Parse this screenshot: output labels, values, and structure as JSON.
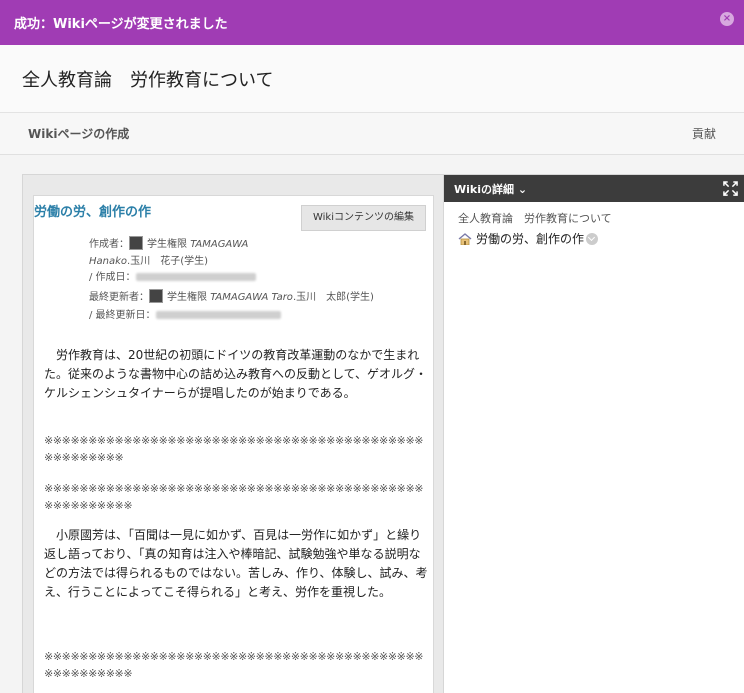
{
  "banner": {
    "message": "成功：Wikiページが変更されました",
    "close_icon": "×"
  },
  "page": {
    "title": "全人教育論　労作教育について"
  },
  "subbar": {
    "left": "Wikiページの作成",
    "right": "貢献"
  },
  "card": {
    "title": "労働の労、創作の作",
    "edit_label": "Wikiコンテンツの編集",
    "author_label": "作成者：",
    "author_name_1": "学生権限",
    "author_name_2": "TAMAGAWA",
    "author_name_3": "Hanako",
    "author_name_4": ".玉川　花子(学生)",
    "created_label": "/ 作成日：",
    "updated_by_label": "最終更新者：",
    "updated_by_1": "学生権限",
    "updated_by_2": "TAMAGAWA Taro",
    "updated_by_3": ".玉川　太郎(学生)",
    "updated_label": "/ 最終更新日：",
    "para1": "　労作教育は、20世紀の初頭にドイツの教育改革運動のなかで生まれた。従来のような書物中心の詰め込み教育への反動として、ゲオルグ・ケルシェンシュタイナーらが提唱したのが始まりである。",
    "marks1": "※※※※※※※※※※※※※※※※※※※※※※※※※※※※※※※※※※※※※※※※※※※※※※※※※※※※",
    "marks2": "※※※※※※※※※※※※※※※※※※※※※※※※※※※※※※※※※※※※※※※※※※※※※※※※※※※※※",
    "para2": "　小原國芳は、「百聞は一見に如かず、百見は一労作に如かず」と繰り返し語っており、「真の知育は注入や棒暗記、試験勉強や単なる説明などの方法では得られるものではない。苦しみ、作り、体験し、試み、考え、行うことによってこそ得られる」と考え、労作を重視した。",
    "marks3": "※※※※※※※※※※※※※※※※※※※※※※※※※※※※※※※※※※※※※※※※※※※※※※※※※※※※※"
  },
  "detail": {
    "title": "Wikiの詳細",
    "chevron": "⌄",
    "root": "全人教育論　労作教育について",
    "page": "労働の労、創作の作"
  }
}
